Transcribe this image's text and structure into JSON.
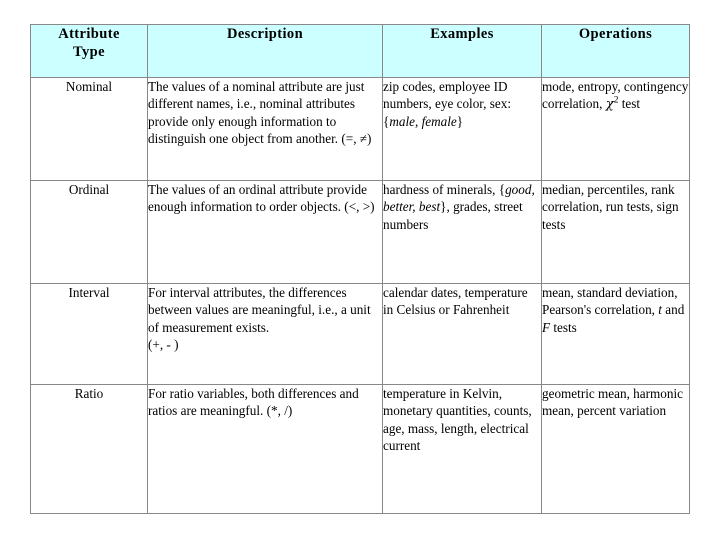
{
  "table": {
    "caption_visible": false,
    "header_background": "#ccffff",
    "border_color": "#888888",
    "columns": [
      {
        "key": "type",
        "label": "Attribute Type"
      },
      {
        "key": "description",
        "label": "Description"
      },
      {
        "key": "examples",
        "label": "Examples"
      },
      {
        "key": "operations",
        "label": "Operations"
      }
    ],
    "header_lines": {
      "type": [
        "Attribute",
        "Type"
      ],
      "description": [
        "Description"
      ],
      "examples": [
        "Examples"
      ],
      "operations": [
        "Operations"
      ]
    },
    "rows": [
      {
        "type": "Nominal",
        "description_pre": "The values of a nominal attribute are just different names, i.e., nominal attributes provide only enough information to distinguish one object from another. (=, ≠)",
        "examples_pre": "zip codes, employee ID numbers, eye color, sex: {",
        "examples_italic": "male, female",
        "examples_post": "}",
        "operations_pre": "mode, entropy, contingency correlation, ",
        "operations_symbol": "χ",
        "operations_sup": "2",
        "operations_post": " test"
      },
      {
        "type": "Ordinal",
        "description_pre": "The values of an ordinal attribute provide enough information to order objects. (<, >)",
        "examples_pre": "hardness of minerals, {",
        "examples_italic": "good, better, best",
        "examples_post": "}, grades, street numbers",
        "operations_pre": "median, percentiles, rank correlation, run tests, sign tests",
        "operations_symbol": "",
        "operations_sup": "",
        "operations_post": ""
      },
      {
        "type": "Interval",
        "description_pre": "For interval attributes, the differences between values are meaningful, i.e., a unit of measurement exists.",
        "description_extra": "(+, - )",
        "examples_pre": "calendar dates, temperature in Celsius or Fahrenheit",
        "examples_italic": "",
        "examples_post": "",
        "operations_pre": "mean, standard deviation, Pearson's correlation, ",
        "operations_italic_1": "t",
        "operations_mid": " and ",
        "operations_italic_2": "F",
        "operations_post": " tests"
      },
      {
        "type": "Ratio",
        "description_pre": "For ratio variables, both differences and ratios are meaningful. (*, /)",
        "examples_pre": "temperature in Kelvin, monetary quantities, counts, age, mass, length, electrical current",
        "examples_italic": "",
        "examples_post": "",
        "operations_pre": "geometric mean, harmonic mean, percent variation",
        "operations_symbol": "",
        "operations_sup": "",
        "operations_post": ""
      }
    ]
  }
}
